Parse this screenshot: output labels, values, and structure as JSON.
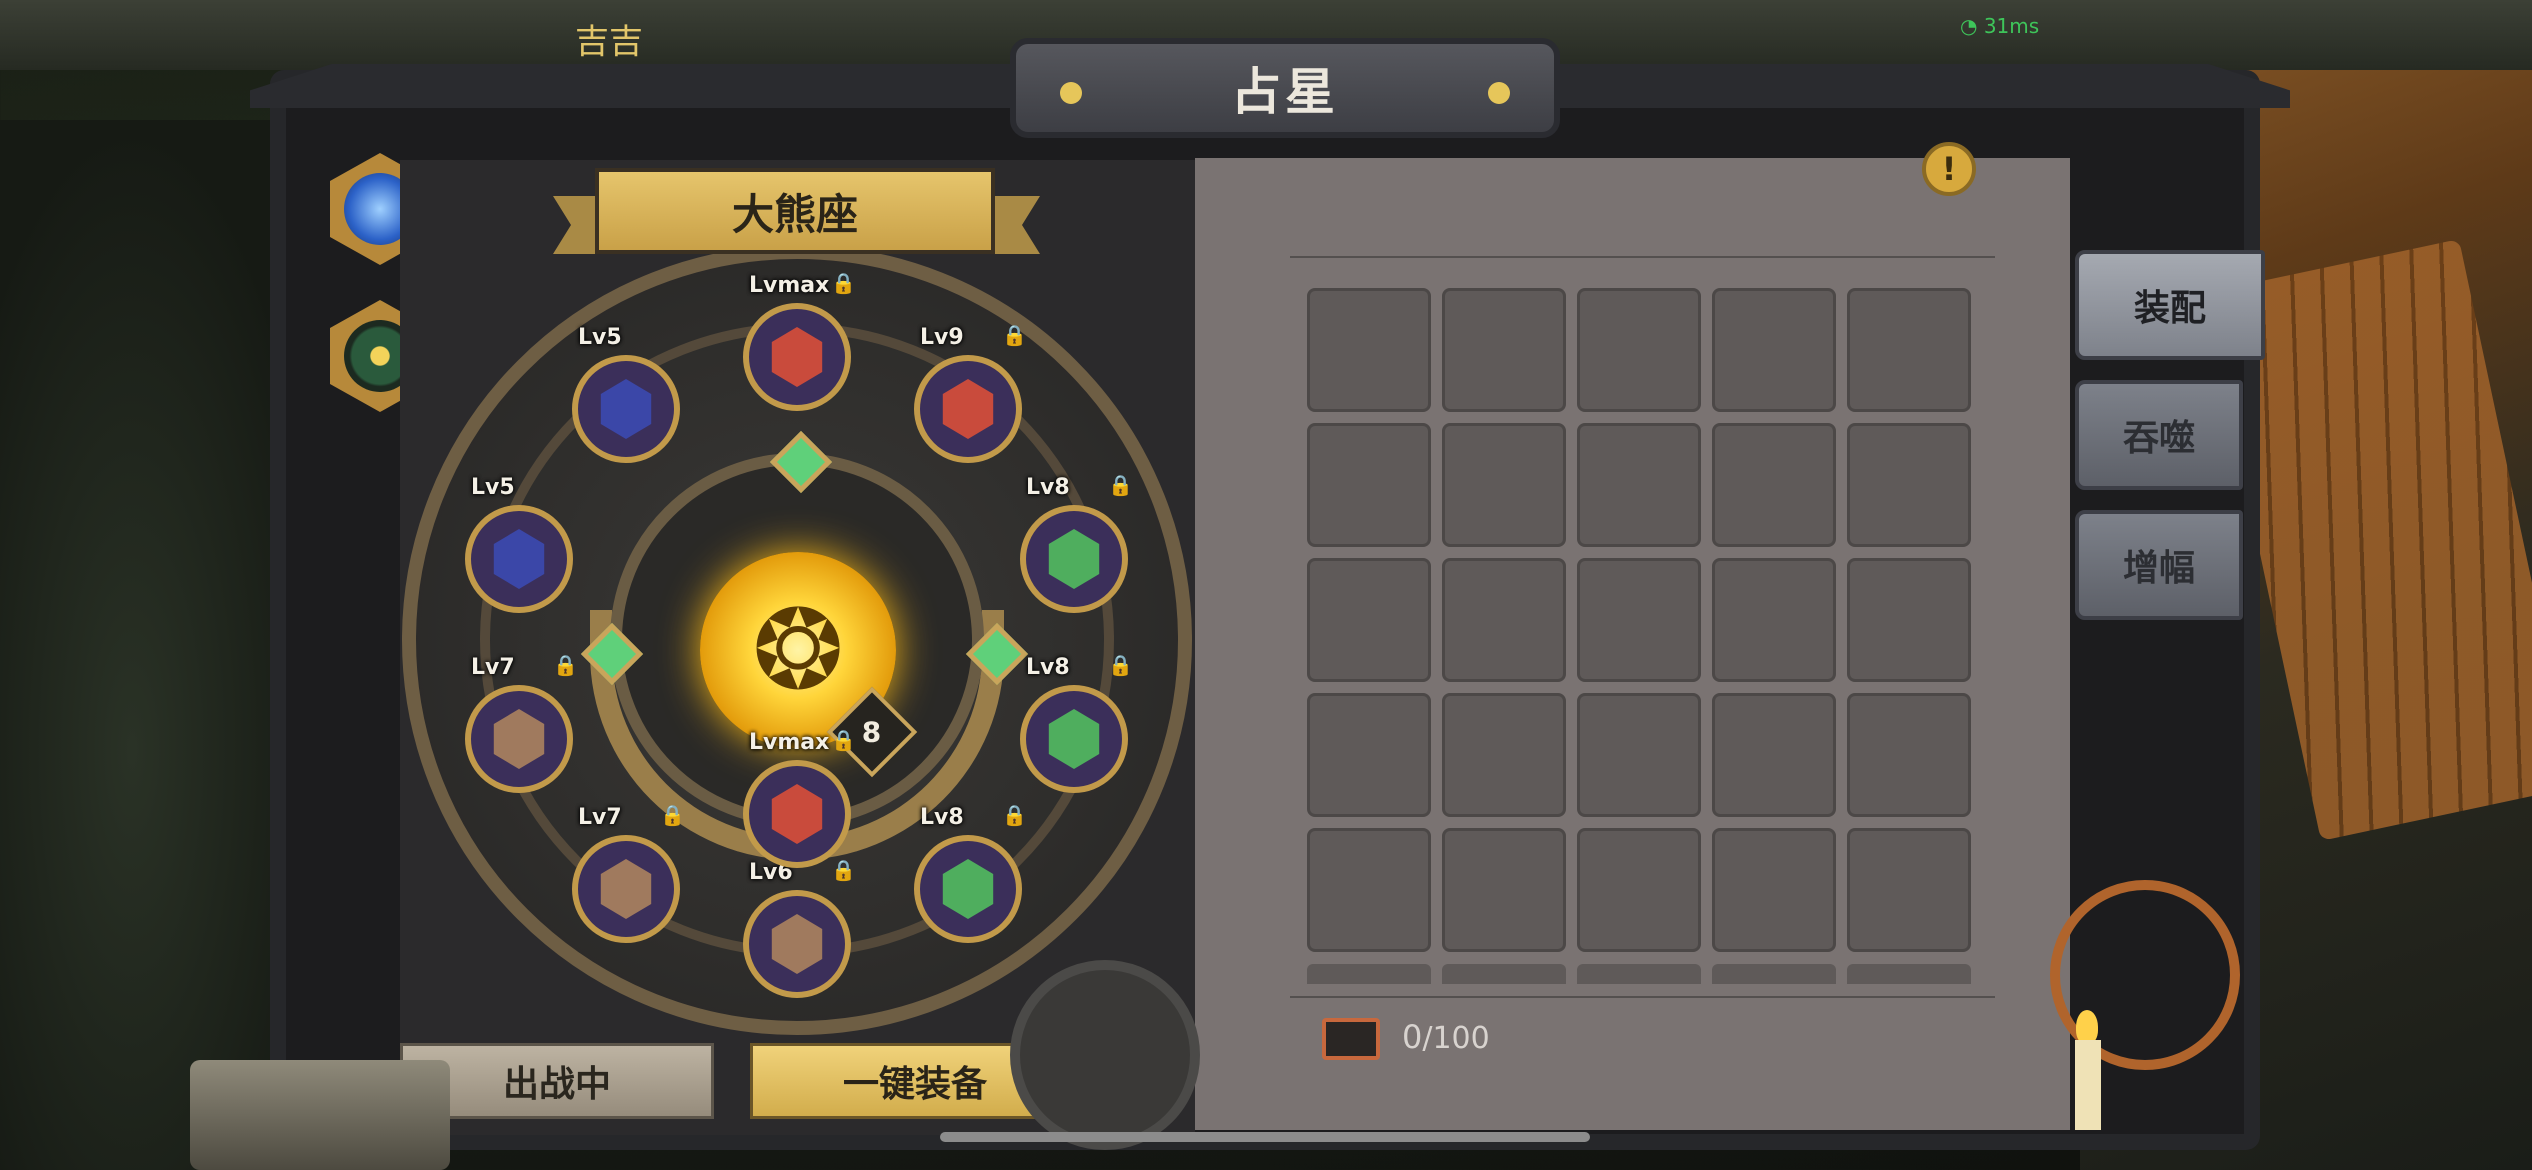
{
  "status": {
    "ping": "31ms"
  },
  "player": {
    "name": "吉吉"
  },
  "header": {
    "title": "占星"
  },
  "constellation": {
    "name": "大熊座",
    "core_level": "8",
    "gems": [
      {
        "label": "Lvmax",
        "color": "red",
        "locked": true
      },
      {
        "label": "Lv9",
        "color": "red",
        "locked": true
      },
      {
        "label": "Lv8",
        "color": "green",
        "locked": true
      },
      {
        "label": "Lv8",
        "color": "green",
        "locked": true
      },
      {
        "label": "Lv8",
        "color": "green",
        "locked": true
      },
      {
        "label": "Lv6",
        "color": "tan",
        "locked": true
      },
      {
        "label": "Lvmax",
        "color": "red",
        "locked": true
      },
      {
        "label": "Lv7",
        "color": "tan",
        "locked": true
      },
      {
        "label": "Lv7",
        "color": "tan",
        "locked": true
      },
      {
        "label": "Lv5",
        "color": "blue",
        "locked": false
      },
      {
        "label": "Lv5",
        "color": "blue",
        "locked": false
      }
    ]
  },
  "buttons": {
    "deploy": "出战中",
    "equip_all": "一键装备"
  },
  "tabs": {
    "equip": "装配",
    "devour": "吞噬",
    "amplify": "增幅"
  },
  "inventory": {
    "count": "0",
    "capacity": "/100"
  },
  "colors": {
    "gold": "#d2ad4c",
    "gem_red": "#c94b3c",
    "gem_green": "#4fae5e",
    "gem_blue": "#3b47a8",
    "gem_tan": "#a07a5e",
    "panel": "#7a7372"
  },
  "icons": {
    "lock": "lock-icon",
    "chest": "chest-icon",
    "info": "info-icon",
    "side_menu": [
      "swirl-icon",
      "eye-icon"
    ]
  }
}
